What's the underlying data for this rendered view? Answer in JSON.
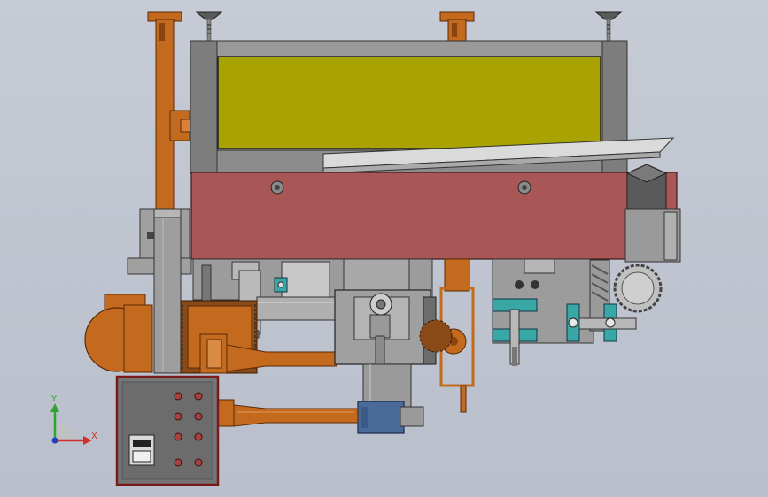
{
  "app": {
    "view": "cad-3d-viewport"
  },
  "triad": {
    "y_label": "Y",
    "x_label": "X"
  },
  "colors": {
    "background": "#bfc5d0",
    "frame_gray": "#8c8c8c",
    "yellow_panel": "#a8a300",
    "red_beam": "#a85656",
    "orange_parts": "#c46a1e",
    "control_box": "#757575",
    "teal_bearings": "#3aa7a7",
    "blue_motor": "#4a6a9a"
  },
  "icons": {
    "triad": "coordinate-triad-icon",
    "y_axis": "y-axis-arrow-icon",
    "x_axis": "x-axis-arrow-icon"
  }
}
